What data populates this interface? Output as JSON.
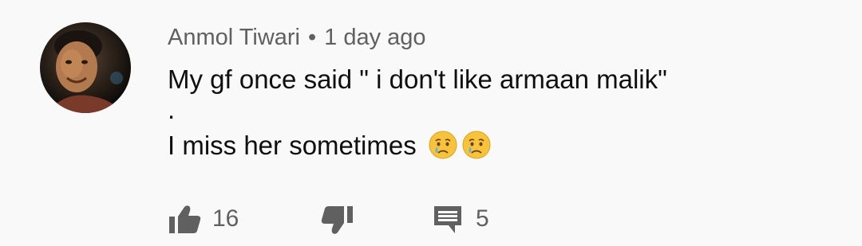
{
  "comment": {
    "author": "Anmol Tiwari",
    "separator": "•",
    "time": "1 day ago",
    "lines": [
      "My gf once said \" i don't like armaan malik\"",
      ".",
      "I miss her sometimes"
    ],
    "emojis": [
      "crying-face",
      "crying-face"
    ],
    "likes": "16",
    "replies": "5"
  },
  "icons": {
    "like": "thumbs-up-icon",
    "dislike": "thumbs-down-icon",
    "reply": "reply-icon"
  },
  "colors": {
    "background": "#f9f9f9",
    "meta_text": "#606060",
    "body_text": "#0f0f0f",
    "icon": "#606060"
  }
}
